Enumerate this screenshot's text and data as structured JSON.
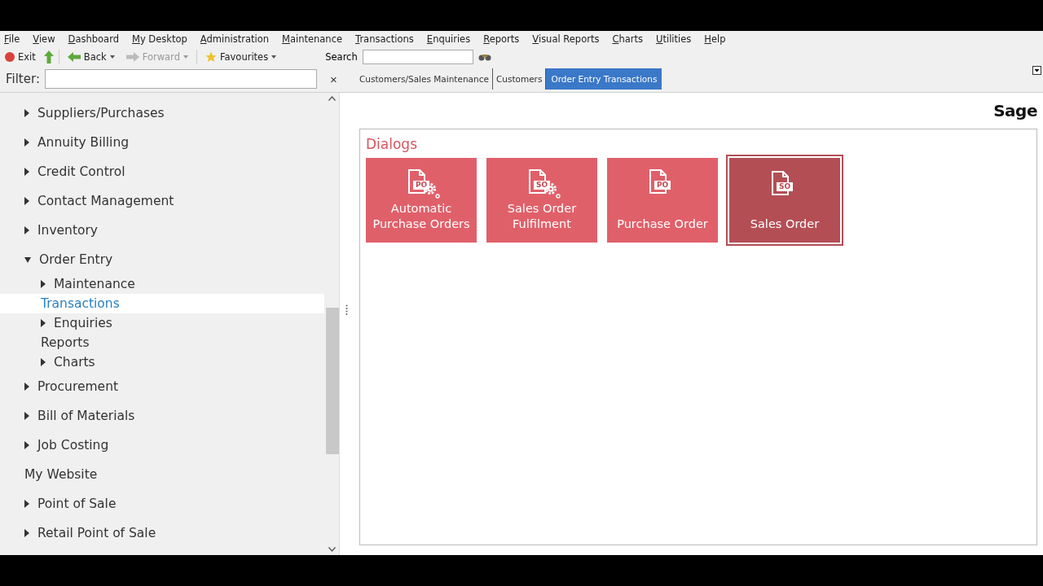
{
  "menu": [
    {
      "label": "File"
    },
    {
      "label": "View"
    },
    {
      "label": "Dashboard"
    },
    {
      "label": "My Desktop"
    },
    {
      "label": "Administration"
    },
    {
      "label": "Maintenance"
    },
    {
      "label": "Transactions"
    },
    {
      "label": "Enquiries"
    },
    {
      "label": "Reports"
    },
    {
      "label": "Visual Reports"
    },
    {
      "label": "Charts"
    },
    {
      "label": "Utilities"
    },
    {
      "label": "Help"
    }
  ],
  "toolbar": {
    "exit": "Exit",
    "back": "Back",
    "forward": "Forward",
    "forward_disabled": true,
    "favourites": "Favourites",
    "search_label": "Search"
  },
  "filter": {
    "label": "Filter:",
    "clear": "×"
  },
  "tabs": [
    {
      "label": "Customers/Sales Maintenance",
      "selected": false
    },
    {
      "label": "Customers",
      "selected": false
    },
    {
      "label": "Order Entry Transactions",
      "selected": true
    }
  ],
  "tree": [
    {
      "label": "Suppliers/Purchases",
      "kind": "group",
      "expanded": false,
      "selected": false
    },
    {
      "label": "Annuity Billing",
      "kind": "group",
      "expanded": false,
      "selected": false
    },
    {
      "label": "Credit Control",
      "kind": "group",
      "expanded": false,
      "selected": false
    },
    {
      "label": "Contact Management",
      "kind": "group",
      "expanded": false,
      "selected": false
    },
    {
      "label": "Inventory",
      "kind": "group",
      "expanded": false,
      "selected": false
    },
    {
      "label": "Order Entry",
      "kind": "group",
      "expanded": true,
      "selected": false,
      "children": [
        {
          "label": "Maintenance",
          "kind": "group",
          "expanded": false,
          "selected": false
        },
        {
          "label": "Transactions",
          "kind": "leaf",
          "selected": true
        },
        {
          "label": "Enquiries",
          "kind": "group",
          "expanded": false,
          "selected": false
        },
        {
          "label": "Reports",
          "kind": "leaf",
          "selected": false
        },
        {
          "label": "Charts",
          "kind": "group",
          "expanded": false,
          "selected": false
        }
      ]
    },
    {
      "label": "Procurement",
      "kind": "group",
      "expanded": false,
      "selected": false
    },
    {
      "label": "Bill of Materials",
      "kind": "group",
      "expanded": false,
      "selected": false
    },
    {
      "label": "Job Costing",
      "kind": "group",
      "expanded": false,
      "selected": false
    },
    {
      "label": "My Website",
      "kind": "leaf",
      "selected": false
    },
    {
      "label": "Point of Sale",
      "kind": "group",
      "expanded": false,
      "selected": false
    },
    {
      "label": "Retail Point of Sale",
      "kind": "group",
      "expanded": false,
      "selected": false
    }
  ],
  "logo": "Sage",
  "panel": {
    "title": "Dialogs",
    "tiles": [
      {
        "label": "Automatic Purchase Orders",
        "badge": "PO",
        "gear": true,
        "selected": false
      },
      {
        "label": "Sales Order Fulfilment",
        "badge": "SO",
        "gear": true,
        "selected": false
      },
      {
        "label": "Purchase Order",
        "badge": "PO",
        "gear": false,
        "selected": false
      },
      {
        "label": "Sales Order",
        "badge": "SO",
        "gear": false,
        "selected": true
      }
    ]
  }
}
